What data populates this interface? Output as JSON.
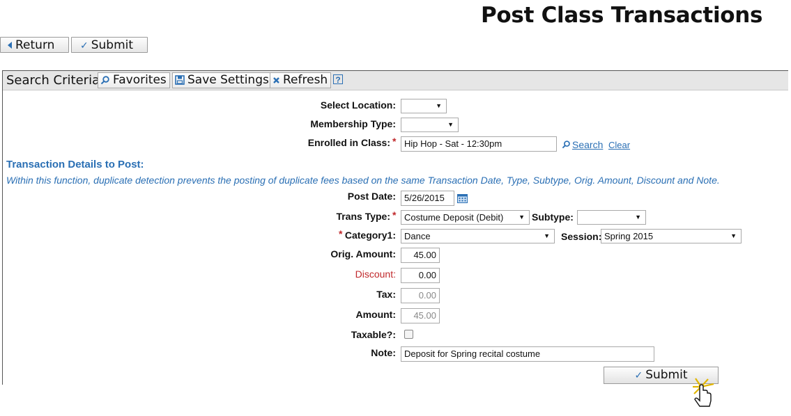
{
  "page": {
    "title": "Post Class Transactions"
  },
  "toolbar": {
    "return_label": "Return",
    "submit_label": "Submit"
  },
  "search_bar": {
    "title": "Search Criteria",
    "favorites_label": "Favorites",
    "save_settings_label": "Save Settings",
    "refresh_label": "Refresh",
    "help_label": "?"
  },
  "criteria": {
    "location_label": "Select Location:",
    "location_value": "",
    "membership_label": "Membership Type:",
    "membership_value": "",
    "class_label": "Enrolled in Class:",
    "class_value": "Hip Hop - Sat - 12:30pm",
    "search_link": "Search",
    "clear_link": "Clear"
  },
  "details": {
    "heading": "Transaction Details to Post:",
    "note": "Within this function, duplicate detection prevents the posting of duplicate fees based on the same Transaction Date, Type, Subtype, Orig. Amount, Discount and Note.",
    "post_date_label": "Post Date:",
    "post_date_value": "5/26/2015",
    "trans_type_label": "Trans Type:",
    "trans_type_value": "Costume Deposit (Debit)",
    "subtype_label": "Subtype:",
    "subtype_value": "",
    "category_label": "Category1:",
    "category_value": "Dance",
    "session_label": "Session:",
    "session_value": "Spring 2015",
    "orig_amount_label": "Orig. Amount:",
    "orig_amount_value": "45.00",
    "discount_label": "Discount:",
    "discount_value": "0.00",
    "tax_label": "Tax:",
    "tax_value": "0.00",
    "amount_label": "Amount:",
    "amount_value": "45.00",
    "taxable_label": "Taxable?:",
    "taxable_checked": false,
    "note_label": "Note:",
    "note_value": "Deposit for Spring  recital costume",
    "submit_label": "Submit"
  },
  "colors": {
    "accent": "#2a6fb4",
    "required": "#c0282b",
    "bar_bg": "#e6e6e6"
  }
}
